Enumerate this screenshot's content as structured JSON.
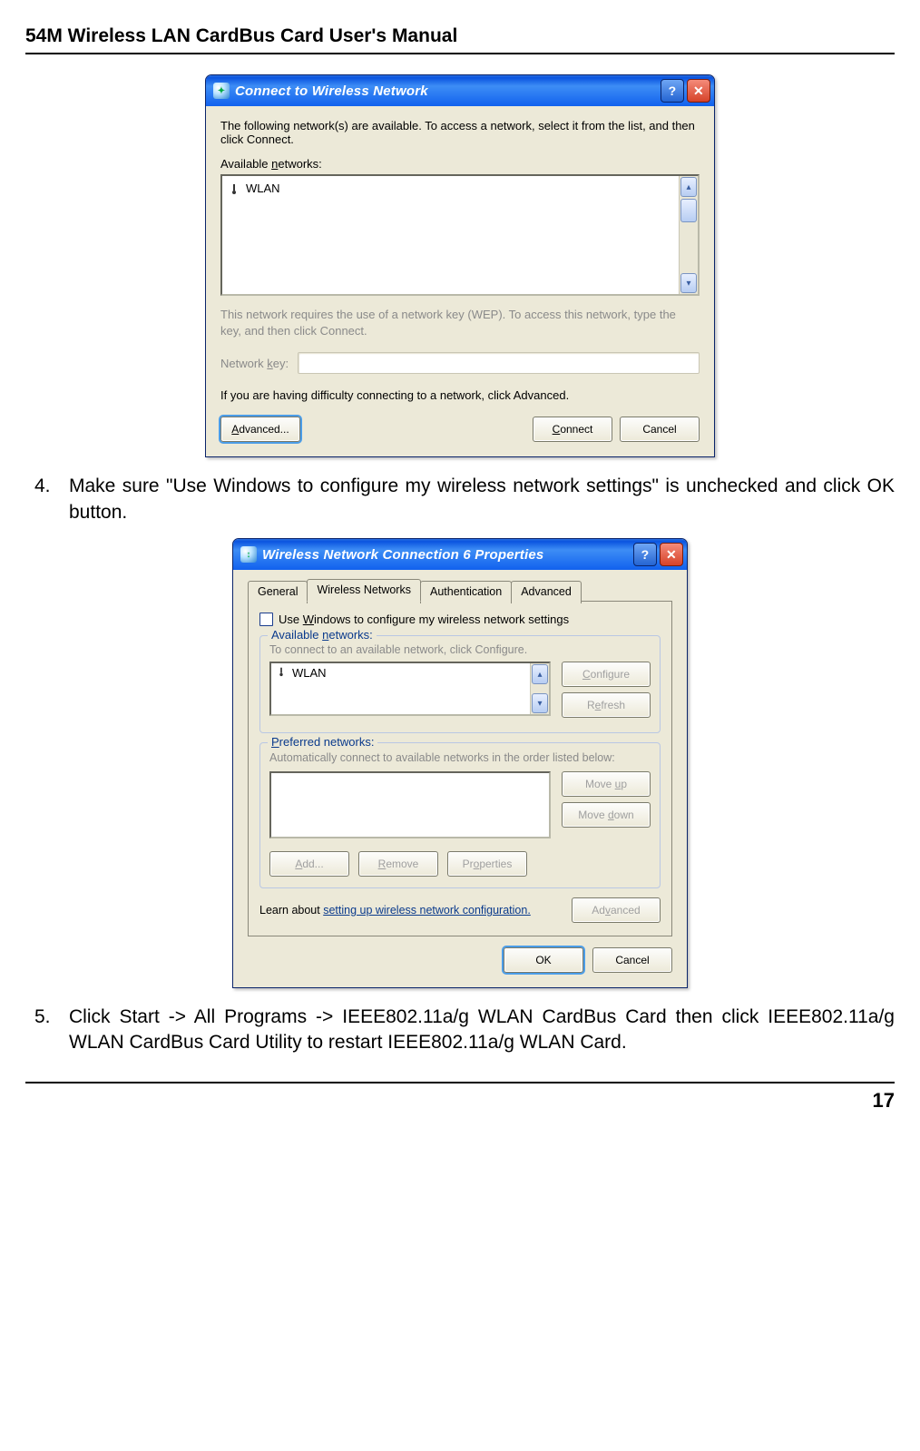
{
  "page": {
    "manual_title": "54M Wireless LAN CardBus Card User's Manual",
    "page_number": "17"
  },
  "step4": {
    "number": "4.",
    "text": "Make sure \"Use Windows to configure my wireless network settings\" is unchecked and click OK button."
  },
  "step5": {
    "number": "5.",
    "text": "Click Start -> All Programs -> IEEE802.11a/g WLAN CardBus Card then click IEEE802.11a/g WLAN CardBus Card Utility to restart IEEE802.11a/g WLAN Card."
  },
  "dialog1": {
    "title": "Connect to Wireless Network",
    "intro": "The following network(s) are available. To access a network, select it from the list, and then click Connect.",
    "available_label": "Available networks:",
    "network_item": "WLAN",
    "wep_hint": "This network requires the use of a network key (WEP). To access this network, type the key, and then click Connect.",
    "key_label": "Network key:",
    "difficulty": "If you are having difficulty connecting to a network, click Advanced.",
    "advanced_btn": "Advanced...",
    "connect_btn": "Connect",
    "cancel_btn": "Cancel"
  },
  "dialog2": {
    "title": "Wireless Network Connection 6 Properties",
    "tabs": {
      "t1": "General",
      "t2": "Wireless Networks",
      "t3": "Authentication",
      "t4": "Advanced"
    },
    "use_windows": "Use Windows to configure my wireless network settings",
    "avail_legend": "Available networks:",
    "avail_hint": "To connect to an available network, click Configure.",
    "avail_item": "WLAN",
    "configure_btn": "Configure",
    "refresh_btn": "Refresh",
    "pref_legend": "Preferred networks:",
    "pref_hint": "Automatically connect to available networks in the order listed below:",
    "moveup_btn": "Move up",
    "movedown_btn": "Move down",
    "add_btn": "Add...",
    "remove_btn": "Remove",
    "properties_btn": "Properties",
    "learn_pre": "Learn about ",
    "learn_link": "setting up wireless network configuration.",
    "adv_btn": "Advanced",
    "ok_btn": "OK",
    "cancel_btn": "Cancel"
  }
}
